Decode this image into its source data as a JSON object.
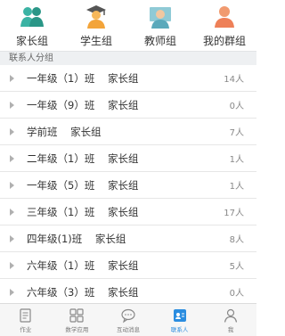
{
  "top_tabs": [
    {
      "label": "家长组",
      "icon": "parents-icon",
      "color": "#2fa79b"
    },
    {
      "label": "学生组",
      "icon": "graduate-icon",
      "color": "#f3a43a"
    },
    {
      "label": "教师组",
      "icon": "teacher-icon",
      "color": "#6bb7c8"
    },
    {
      "label": "我的群组",
      "icon": "my-group-icon",
      "color": "#f08a5d"
    }
  ],
  "section_header": "联系人分组",
  "groups": [
    {
      "name": "一年级（1）班    家长组",
      "count": "14人"
    },
    {
      "name": "一年级（9）班    家长组",
      "count": "0人"
    },
    {
      "name": "学前班    家长组",
      "count": "7人"
    },
    {
      "name": "二年级（1）班    家长组",
      "count": "1人"
    },
    {
      "name": "一年级（5）班    家长组",
      "count": "1人"
    },
    {
      "name": "三年级（1）班    家长组",
      "count": "17人"
    },
    {
      "name": "四年级(1)班    家长组",
      "count": "8人"
    },
    {
      "name": "六年级（1）班    家长组",
      "count": "5人"
    },
    {
      "name": "六年级（3）班    家长组",
      "count": "0人"
    }
  ],
  "bottom_nav": [
    {
      "label": "作业",
      "icon": "homework-icon",
      "active": false
    },
    {
      "label": "数学应用",
      "icon": "apps-icon",
      "active": false
    },
    {
      "label": "互动消息",
      "icon": "message-icon",
      "active": false
    },
    {
      "label": "联系人",
      "icon": "contacts-icon",
      "active": true
    },
    {
      "label": "我",
      "icon": "me-icon",
      "active": false
    }
  ],
  "colors": {
    "accent": "#2b8de0",
    "section_bg": "#eef0f2"
  }
}
